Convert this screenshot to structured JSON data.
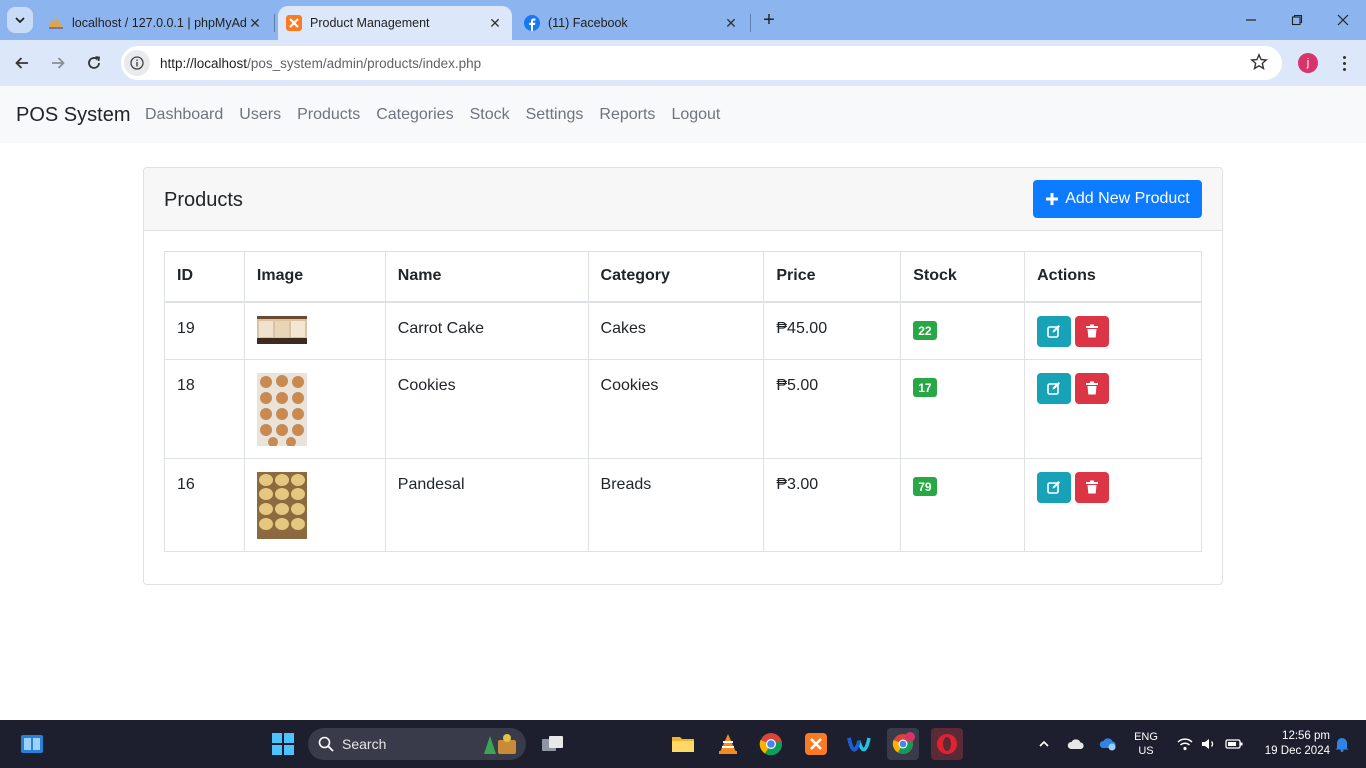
{
  "browser": {
    "tabs": [
      {
        "title": "localhost / 127.0.0.1 | phpMyAd",
        "icon": "phpmyadmin-icon"
      },
      {
        "title": "Product Management",
        "icon": "xampp-icon"
      },
      {
        "title": "(11) Facebook",
        "icon": "facebook-icon"
      }
    ],
    "url_host": "http://localhost",
    "url_path": "/pos_system/admin/products/index.php",
    "profile_initial": "j"
  },
  "app": {
    "brand": "POS System",
    "nav": [
      "Dashboard",
      "Users",
      "Products",
      "Categories",
      "Stock",
      "Settings",
      "Reports",
      "Logout"
    ]
  },
  "products": {
    "title": "Products",
    "add_button": "Add New Product",
    "columns": [
      "ID",
      "Image",
      "Name",
      "Category",
      "Price",
      "Stock",
      "Actions"
    ],
    "rows": [
      {
        "id": "19",
        "name": "Carrot Cake",
        "category": "Cakes",
        "price": "₱45.00",
        "stock": "22"
      },
      {
        "id": "18",
        "name": "Cookies",
        "category": "Cookies",
        "price": "₱5.00",
        "stock": "17"
      },
      {
        "id": "16",
        "name": "Pandesal",
        "category": "Breads",
        "price": "₱3.00",
        "stock": "79"
      }
    ]
  },
  "taskbar": {
    "search_placeholder": "Search",
    "lang_line1": "ENG",
    "lang_line2": "US",
    "time": "12:56 pm",
    "date": "19 Dec 2024"
  },
  "colors": {
    "primary": "#0d7bff",
    "edit": "#17a2b8",
    "delete": "#dc3545",
    "stock_badge": "#28a745"
  }
}
